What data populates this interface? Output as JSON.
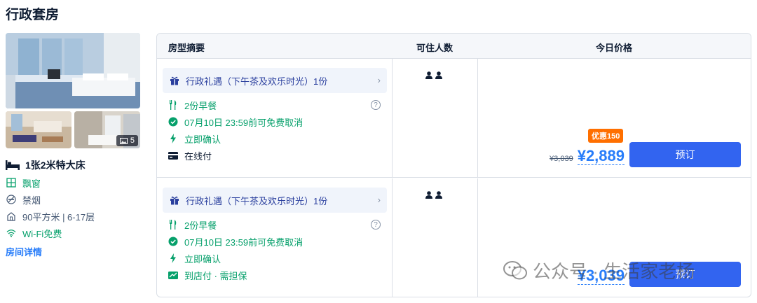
{
  "page": {
    "title": "行政套房"
  },
  "room": {
    "photo_count": "5",
    "bed": "1张2米特大床",
    "features": [
      {
        "icon": "window-icon",
        "text": "飘窗",
        "green": true
      },
      {
        "icon": "no-smoking-icon",
        "text": "禁烟",
        "green": false
      },
      {
        "icon": "room-size-icon",
        "text": "90平方米 | 6-17层",
        "green": false
      },
      {
        "icon": "wifi-icon",
        "text": "Wi-Fi免费",
        "green": true
      }
    ],
    "detail_link": "房间详情"
  },
  "table": {
    "headers": {
      "summary": "房型摘要",
      "occupancy": "可住人数",
      "price": "今日价格"
    }
  },
  "offers": [
    {
      "gift": "行政礼遇（下午茶及欢乐时光）1份",
      "breakfast": "2份早餐",
      "cancel": "07月10日 23:59前可免费取消",
      "confirm": "立即确认",
      "payment": "在线付",
      "discount": "优惠150",
      "original_price": "¥3,039",
      "price": "¥2,889",
      "book": "预订"
    },
    {
      "gift": "行政礼遇（下午茶及欢乐时光）1份",
      "breakfast": "2份早餐",
      "cancel": "07月10日 23:59前可免费取消",
      "confirm": "立即确认",
      "payment": "到店付 · 需担保",
      "price": "¥3,039",
      "book": "预订"
    }
  ],
  "watermark": "公众号 · 生活家老杨",
  "colors": {
    "accent": "#287dfa",
    "button": "#3264f0",
    "green": "#06a06b",
    "discount": "#ff6f00",
    "gift_text": "#2a3f9e"
  }
}
